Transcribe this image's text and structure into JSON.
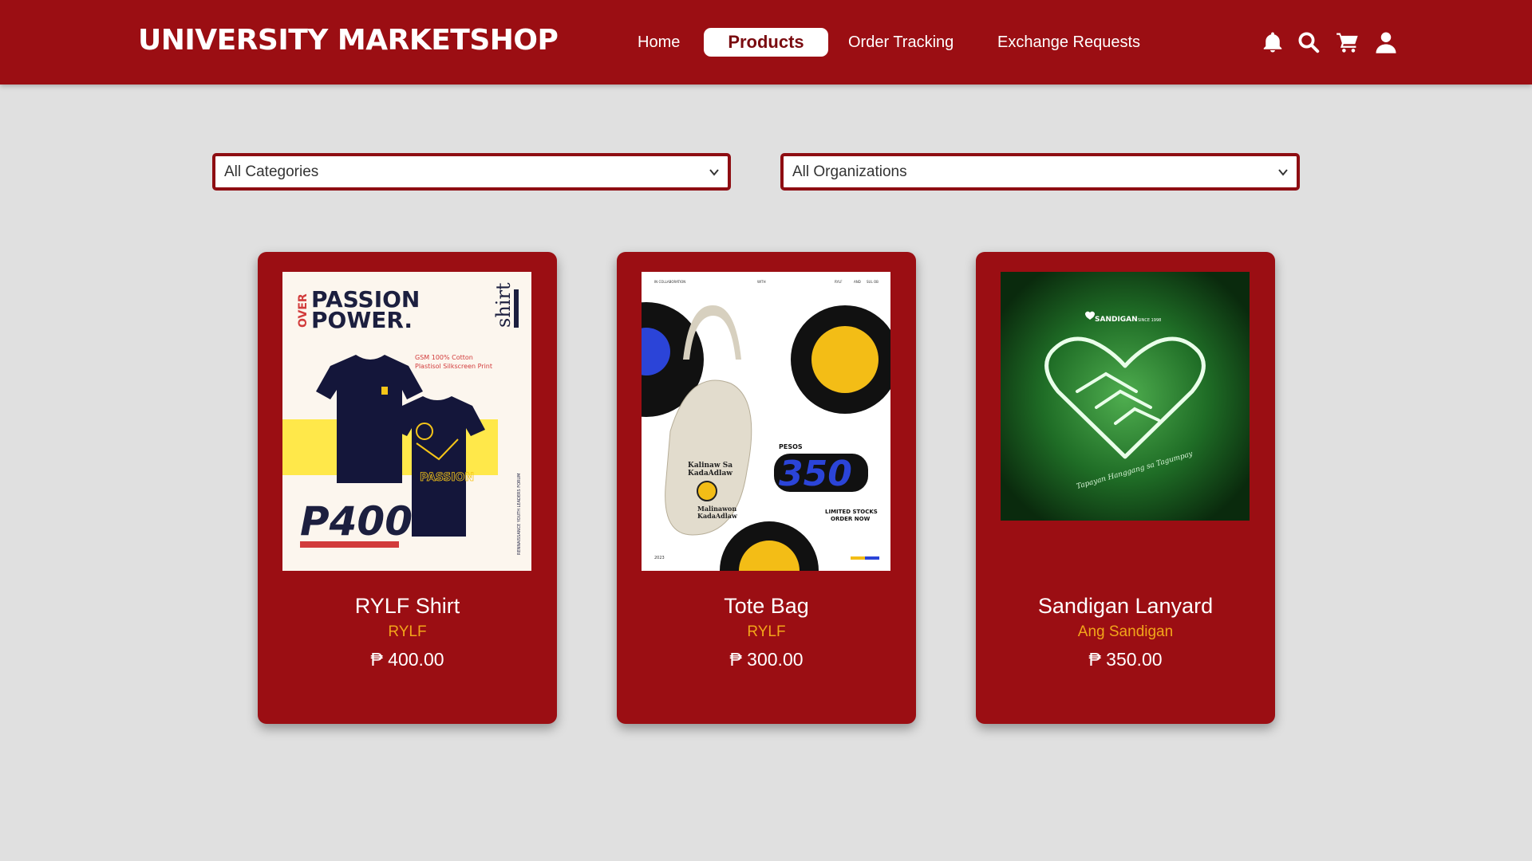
{
  "header": {
    "brand": "UNIVERSITY MARKETSHOP",
    "nav": [
      {
        "label": "Home"
      },
      {
        "label": "Products",
        "active": true
      },
      {
        "label": "Order Tracking"
      },
      {
        "label": "Exchange Requests"
      }
    ],
    "icons": [
      "bell-icon",
      "search-icon",
      "cart-icon",
      "user-icon"
    ]
  },
  "filters": {
    "category": {
      "selected": "All Categories"
    },
    "organization": {
      "selected": "All Organizations"
    }
  },
  "products": [
    {
      "name": "RYLF Shirt",
      "organization": "RYLF",
      "price": "₱ 400.00",
      "image_text": {
        "over": "OVER",
        "headline1": "PASSION",
        "headline2": "POWER.",
        "tag": "shirt",
        "spec1": "GSM 100% Cotton",
        "spec2": "Plastisol Silkscreen Print",
        "price": "P400",
        "side": "RENNAISSANCE YOUTH LEADERS FORUM"
      }
    },
    {
      "name": "Tote Bag",
      "organization": "RYLF",
      "price": "₱ 300.00",
      "image_text": {
        "collab": "IN COLLABORATION",
        "with": "WITH",
        "rylf": "RYLF",
        "and": "AND",
        "sulob": "SUL OB",
        "pesos": "PESOS",
        "price": "350",
        "stock1": "LIMITED STOCKS",
        "stock2": "ORDER NOW",
        "year": "2023",
        "bag1": "Kalinaw Sa",
        "bag2": "KadaAdlaw",
        "bag3": "Malinawon",
        "bag4": "KadaAdlaw"
      }
    },
    {
      "name": "Sandigan Lanyard",
      "organization": "Ang Sandigan",
      "price": "₱ 350.00",
      "image_text": {
        "logo": "SANDIGAN",
        "since": "SINCE 1998",
        "motto": "Tapayan Hanggang sa Tagumpay"
      }
    }
  ],
  "colors": {
    "primary": "#9b0e13",
    "background": "#e0e0e0",
    "accent_org": "#f2a51a"
  }
}
